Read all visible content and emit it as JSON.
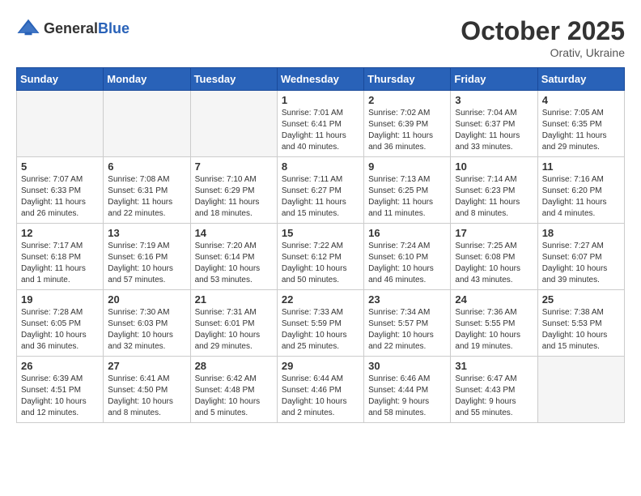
{
  "header": {
    "logo_general": "General",
    "logo_blue": "Blue",
    "month_year": "October 2025",
    "location": "Orativ, Ukraine"
  },
  "weekdays": [
    "Sunday",
    "Monday",
    "Tuesday",
    "Wednesday",
    "Thursday",
    "Friday",
    "Saturday"
  ],
  "weeks": [
    [
      {
        "day": "",
        "info": ""
      },
      {
        "day": "",
        "info": ""
      },
      {
        "day": "",
        "info": ""
      },
      {
        "day": "1",
        "info": "Sunrise: 7:01 AM\nSunset: 6:41 PM\nDaylight: 11 hours\nand 40 minutes."
      },
      {
        "day": "2",
        "info": "Sunrise: 7:02 AM\nSunset: 6:39 PM\nDaylight: 11 hours\nand 36 minutes."
      },
      {
        "day": "3",
        "info": "Sunrise: 7:04 AM\nSunset: 6:37 PM\nDaylight: 11 hours\nand 33 minutes."
      },
      {
        "day": "4",
        "info": "Sunrise: 7:05 AM\nSunset: 6:35 PM\nDaylight: 11 hours\nand 29 minutes."
      }
    ],
    [
      {
        "day": "5",
        "info": "Sunrise: 7:07 AM\nSunset: 6:33 PM\nDaylight: 11 hours\nand 26 minutes."
      },
      {
        "day": "6",
        "info": "Sunrise: 7:08 AM\nSunset: 6:31 PM\nDaylight: 11 hours\nand 22 minutes."
      },
      {
        "day": "7",
        "info": "Sunrise: 7:10 AM\nSunset: 6:29 PM\nDaylight: 11 hours\nand 18 minutes."
      },
      {
        "day": "8",
        "info": "Sunrise: 7:11 AM\nSunset: 6:27 PM\nDaylight: 11 hours\nand 15 minutes."
      },
      {
        "day": "9",
        "info": "Sunrise: 7:13 AM\nSunset: 6:25 PM\nDaylight: 11 hours\nand 11 minutes."
      },
      {
        "day": "10",
        "info": "Sunrise: 7:14 AM\nSunset: 6:23 PM\nDaylight: 11 hours\nand 8 minutes."
      },
      {
        "day": "11",
        "info": "Sunrise: 7:16 AM\nSunset: 6:20 PM\nDaylight: 11 hours\nand 4 minutes."
      }
    ],
    [
      {
        "day": "12",
        "info": "Sunrise: 7:17 AM\nSunset: 6:18 PM\nDaylight: 11 hours\nand 1 minute."
      },
      {
        "day": "13",
        "info": "Sunrise: 7:19 AM\nSunset: 6:16 PM\nDaylight: 10 hours\nand 57 minutes."
      },
      {
        "day": "14",
        "info": "Sunrise: 7:20 AM\nSunset: 6:14 PM\nDaylight: 10 hours\nand 53 minutes."
      },
      {
        "day": "15",
        "info": "Sunrise: 7:22 AM\nSunset: 6:12 PM\nDaylight: 10 hours\nand 50 minutes."
      },
      {
        "day": "16",
        "info": "Sunrise: 7:24 AM\nSunset: 6:10 PM\nDaylight: 10 hours\nand 46 minutes."
      },
      {
        "day": "17",
        "info": "Sunrise: 7:25 AM\nSunset: 6:08 PM\nDaylight: 10 hours\nand 43 minutes."
      },
      {
        "day": "18",
        "info": "Sunrise: 7:27 AM\nSunset: 6:07 PM\nDaylight: 10 hours\nand 39 minutes."
      }
    ],
    [
      {
        "day": "19",
        "info": "Sunrise: 7:28 AM\nSunset: 6:05 PM\nDaylight: 10 hours\nand 36 minutes."
      },
      {
        "day": "20",
        "info": "Sunrise: 7:30 AM\nSunset: 6:03 PM\nDaylight: 10 hours\nand 32 minutes."
      },
      {
        "day": "21",
        "info": "Sunrise: 7:31 AM\nSunset: 6:01 PM\nDaylight: 10 hours\nand 29 minutes."
      },
      {
        "day": "22",
        "info": "Sunrise: 7:33 AM\nSunset: 5:59 PM\nDaylight: 10 hours\nand 25 minutes."
      },
      {
        "day": "23",
        "info": "Sunrise: 7:34 AM\nSunset: 5:57 PM\nDaylight: 10 hours\nand 22 minutes."
      },
      {
        "day": "24",
        "info": "Sunrise: 7:36 AM\nSunset: 5:55 PM\nDaylight: 10 hours\nand 19 minutes."
      },
      {
        "day": "25",
        "info": "Sunrise: 7:38 AM\nSunset: 5:53 PM\nDaylight: 10 hours\nand 15 minutes."
      }
    ],
    [
      {
        "day": "26",
        "info": "Sunrise: 6:39 AM\nSunset: 4:51 PM\nDaylight: 10 hours\nand 12 minutes."
      },
      {
        "day": "27",
        "info": "Sunrise: 6:41 AM\nSunset: 4:50 PM\nDaylight: 10 hours\nand 8 minutes."
      },
      {
        "day": "28",
        "info": "Sunrise: 6:42 AM\nSunset: 4:48 PM\nDaylight: 10 hours\nand 5 minutes."
      },
      {
        "day": "29",
        "info": "Sunrise: 6:44 AM\nSunset: 4:46 PM\nDaylight: 10 hours\nand 2 minutes."
      },
      {
        "day": "30",
        "info": "Sunrise: 6:46 AM\nSunset: 4:44 PM\nDaylight: 9 hours\nand 58 minutes."
      },
      {
        "day": "31",
        "info": "Sunrise: 6:47 AM\nSunset: 4:43 PM\nDaylight: 9 hours\nand 55 minutes."
      },
      {
        "day": "",
        "info": ""
      }
    ]
  ]
}
